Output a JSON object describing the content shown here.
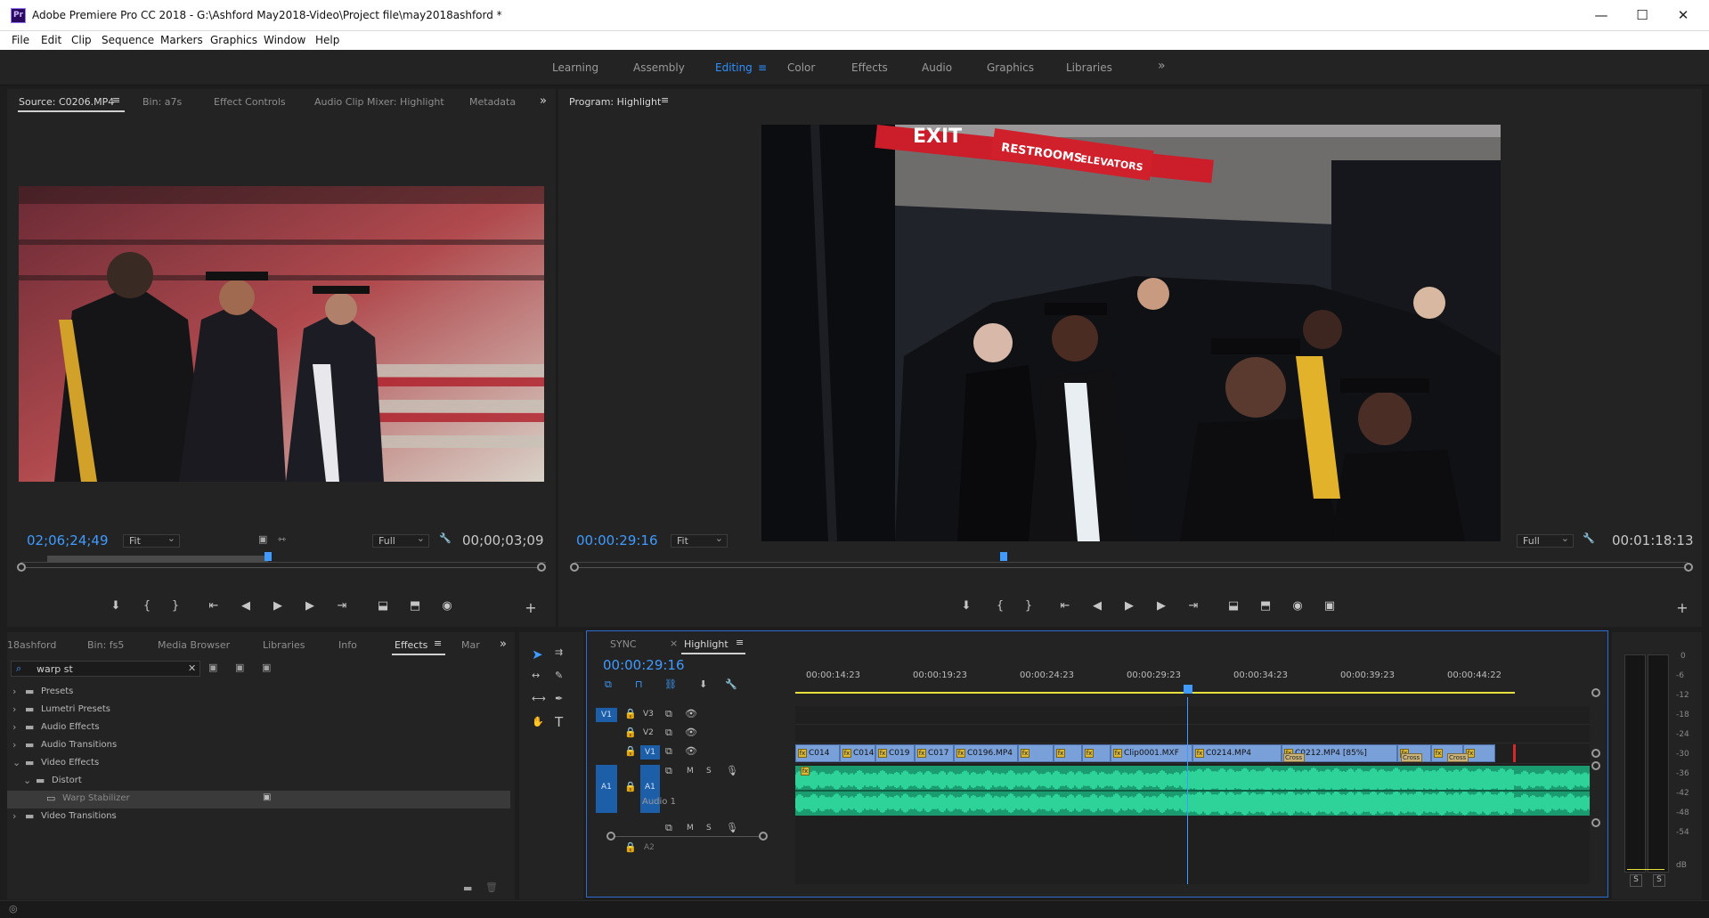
{
  "titlebar": {
    "app_icon": "Pr",
    "title": "Adobe Premiere Pro CC 2018 - G:\\Ashford May2018-Video\\Project file\\may2018ashford *",
    "minimize": "—",
    "maximize": "☐",
    "close": "✕"
  },
  "menu": [
    "File",
    "Edit",
    "Clip",
    "Sequence",
    "Markers",
    "Graphics",
    "Window",
    "Help"
  ],
  "workspaces": [
    "Learning",
    "Assembly",
    "Editing",
    "Color",
    "Effects",
    "Audio",
    "Graphics",
    "Libraries"
  ],
  "workspace_active": "Editing",
  "workspace_more": "»",
  "source": {
    "tabs": [
      "Source: C0206.MP4",
      "Bin: a7s",
      "Effect Controls",
      "Audio Clip Mixer: Highlight",
      "Metadata"
    ],
    "tab_menu": "≡",
    "more": "»",
    "timecode": "02;06;24;49",
    "fit": "Fit",
    "quality": "Full",
    "duration": "00;00;03;09"
  },
  "program": {
    "tab": "Program: Highlight",
    "tab_menu": "≡",
    "timecode": "00:00:29:16",
    "fit": "Fit",
    "quality": "Full",
    "duration": "00:01:18:13",
    "sign_exit": "EXIT",
    "sign_restrooms": "RESTROOMS",
    "sign_elevators": "ELEVATORS"
  },
  "transport": {
    "marker": "⬇",
    "in": "{",
    "out": "}",
    "goto_in": "⇤",
    "step_back": "◀",
    "play": "▶",
    "step_fwd": "▶",
    "goto_out": "⇥",
    "insert": "⬓",
    "overwrite": "⬒",
    "export": "◉",
    "compare": "▣",
    "add": "+"
  },
  "project": {
    "tabs": [
      "18ashford",
      "Bin: fs5",
      "Media Browser",
      "Libraries",
      "Info",
      "Effects",
      "Mar"
    ],
    "active_tab": "Effects",
    "more": "»",
    "search_value": "warp st",
    "tree": [
      {
        "label": "Presets",
        "indent": 0,
        "arrow": "›",
        "kind": "folder-star"
      },
      {
        "label": "Lumetri Presets",
        "indent": 0,
        "arrow": "›",
        "kind": "folder-star"
      },
      {
        "label": "Audio Effects",
        "indent": 0,
        "arrow": "›",
        "kind": "folder"
      },
      {
        "label": "Audio Transitions",
        "indent": 0,
        "arrow": "›",
        "kind": "folder"
      },
      {
        "label": "Video Effects",
        "indent": 0,
        "arrow": "⌄",
        "kind": "folder"
      },
      {
        "label": "Distort",
        "indent": 1,
        "arrow": "⌄",
        "kind": "folder"
      },
      {
        "label": "Warp Stabilizer",
        "indent": 2,
        "arrow": "",
        "kind": "effect",
        "selected": true
      },
      {
        "label": "Video Transitions",
        "indent": 0,
        "arrow": "›",
        "kind": "folder"
      }
    ]
  },
  "timeline": {
    "tabs": [
      "SYNC",
      "Highlight"
    ],
    "tab_close": "×",
    "tab_menu": "≡",
    "timecode": "00:00:29:16",
    "ruler": [
      "00:00:14:23",
      "00:00:19:23",
      "00:00:24:23",
      "00:00:29:23",
      "00:00:34:23",
      "00:00:39:23",
      "00:00:44:22"
    ],
    "tracks": {
      "v3": "V3",
      "v2": "V2",
      "v1": "V1",
      "a1": "A1",
      "a1_name": "Audio 1",
      "a2": "A2",
      "src_v1": "V1",
      "src_a1": "A1",
      "mute": "M",
      "solo": "S"
    },
    "clips": [
      "C014",
      "C014",
      "C019",
      "C017",
      "C0196.MP4",
      "",
      "",
      "",
      "Clip0001.MXF",
      "C0214.MP4",
      "C0212.MP4 [85%]",
      "",
      "",
      ""
    ],
    "transitions": [
      "Cross",
      "Cross",
      "Cross"
    ]
  },
  "meter": {
    "labels": [
      "0",
      "-6",
      "-12",
      "-18",
      "-24",
      "-30",
      "-36",
      "-42",
      "-48",
      "-54",
      "dB"
    ],
    "solo_left": "S",
    "solo_right": "S"
  },
  "colors": {
    "accent": "#2f8fff",
    "audio_wave": "#2ed39a",
    "video_clip": "#7aa0d9",
    "playhead": "#3f9bff",
    "work_area": "#e8e03a"
  }
}
